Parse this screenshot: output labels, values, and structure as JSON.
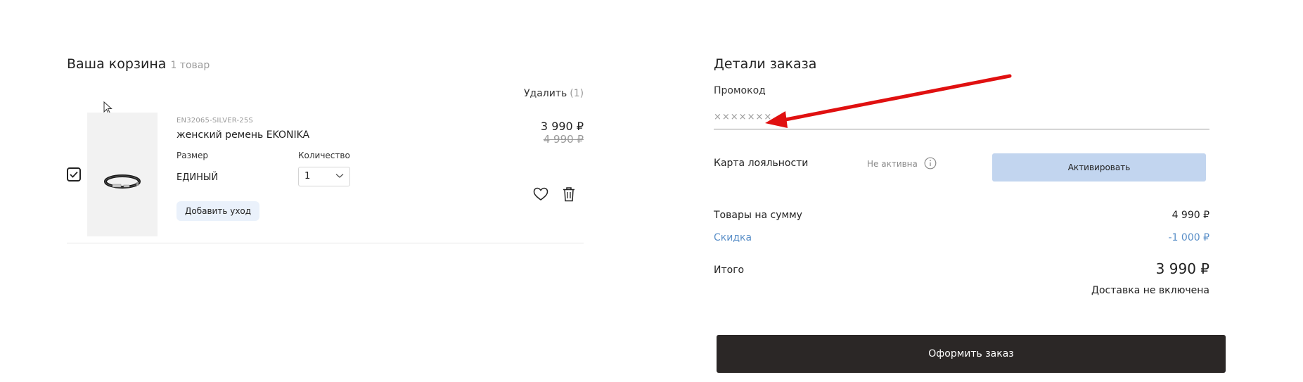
{
  "cart": {
    "title": "Ваша корзина",
    "count": "1 товар",
    "delete_label": "Удалить",
    "delete_count": "(1)",
    "item": {
      "checked": true,
      "sku": "EN32065-SILVER-25S",
      "name": "женский ремень EKONIKA",
      "size_label": "Размер",
      "size_value": "ЕДИНЫЙ",
      "qty_label": "Количество",
      "qty_value": "1",
      "add_care_label": "Добавить уход",
      "price_now": "3 990 ₽",
      "price_old": "4 990 ₽"
    }
  },
  "order": {
    "title": "Детали заказа",
    "promo_label": "Промокод",
    "promo_placeholder": "×××××××",
    "loyalty_label": "Карта лояльности",
    "loyalty_status": "Не активна",
    "activate_label": "Активировать",
    "goods_label": "Товары на сумму",
    "goods_value": "4 990 ₽",
    "discount_label": "Скидка",
    "discount_value": "-1 000 ₽",
    "total_label": "Итого",
    "total_value": "3 990 ₽",
    "delivery_note": "Доставка не включена",
    "checkout_label": "Оформить заказ"
  },
  "icons": {
    "checkbox": "check-icon",
    "favorite": "heart-icon",
    "delete": "trash-icon",
    "dropdown": "chevron-down-icon",
    "info": "info-icon",
    "cursor": "mouse-cursor-icon",
    "annotation": "red-arrow-icon"
  },
  "colors": {
    "accent_link": "#5a8fc8",
    "activate_button": "#c2d5ef",
    "checkout_button": "#2b2726",
    "annotation_arrow": "#e01010"
  }
}
